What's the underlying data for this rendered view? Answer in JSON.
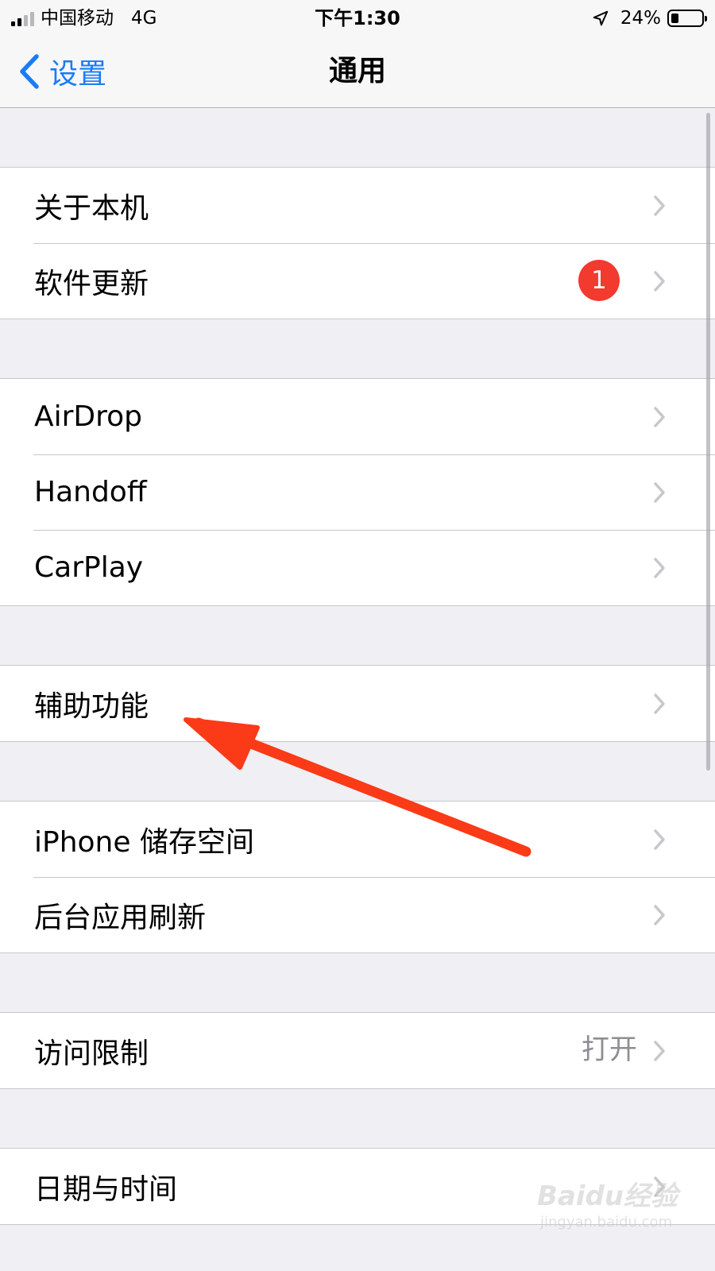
{
  "status_bar": {
    "carrier": "中国移动",
    "network": "4G",
    "time": "下午1:30",
    "battery": "24%",
    "battery_level": 0.24
  },
  "nav": {
    "back_label": "设置",
    "title": "通用"
  },
  "groups": {
    "about": {
      "label": "关于本机"
    },
    "software_update": {
      "label": "软件更新",
      "badge": "1"
    },
    "airdrop": {
      "label": "AirDrop"
    },
    "handoff": {
      "label": "Handoff"
    },
    "carplay": {
      "label": "CarPlay"
    },
    "accessibility": {
      "label": "辅助功能"
    },
    "storage": {
      "label": "iPhone 储存空间"
    },
    "background_refresh": {
      "label": "后台应用刷新"
    },
    "restrictions": {
      "label": "访问限制",
      "value": "打开"
    },
    "date_time": {
      "label": "日期与时间"
    }
  },
  "watermark": {
    "logo": "Baidu经验",
    "url": "jingyan.baidu.com"
  },
  "colors": {
    "accent": "#1a7cf5",
    "badge": "#f23a2e",
    "annotation_arrow": "#fb3a17",
    "background": "#efeff4"
  }
}
